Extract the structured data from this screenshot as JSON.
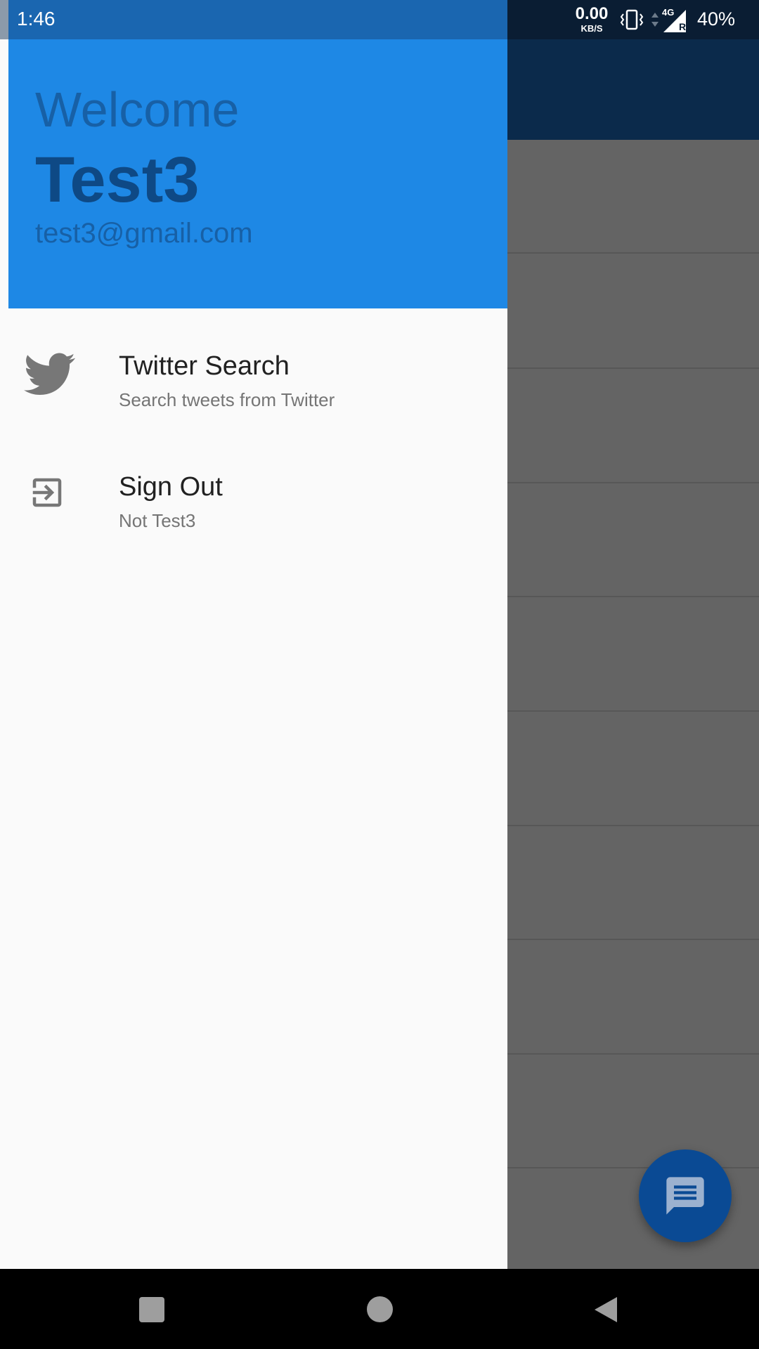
{
  "status_bar": {
    "time": "1:46",
    "net_speed_value": "0.00",
    "net_speed_unit": "KB/S",
    "network_type": "4G",
    "roaming_indicator": "R",
    "battery": "40%",
    "icons": [
      "vibrate-icon",
      "data-arrows-icon",
      "signal-icon"
    ]
  },
  "drawer": {
    "header": {
      "welcome": "Welcome",
      "username": "Test3",
      "email": "test3@gmail.com",
      "background_color": "#1e88e5"
    },
    "items": [
      {
        "icon": "twitter-bird-icon",
        "title": "Twitter Search",
        "subtitle": "Search tweets from Twitter"
      },
      {
        "icon": "sign-out-icon",
        "title": "Sign Out",
        "subtitle": "Not Test3"
      }
    ]
  },
  "background": {
    "app_bar_color": "#0b2a4b",
    "fab_icon": "chat-icon",
    "fab_color": "#0a4a94"
  },
  "nav_bar": {
    "buttons": [
      "recents-button",
      "home-button",
      "back-button"
    ]
  }
}
